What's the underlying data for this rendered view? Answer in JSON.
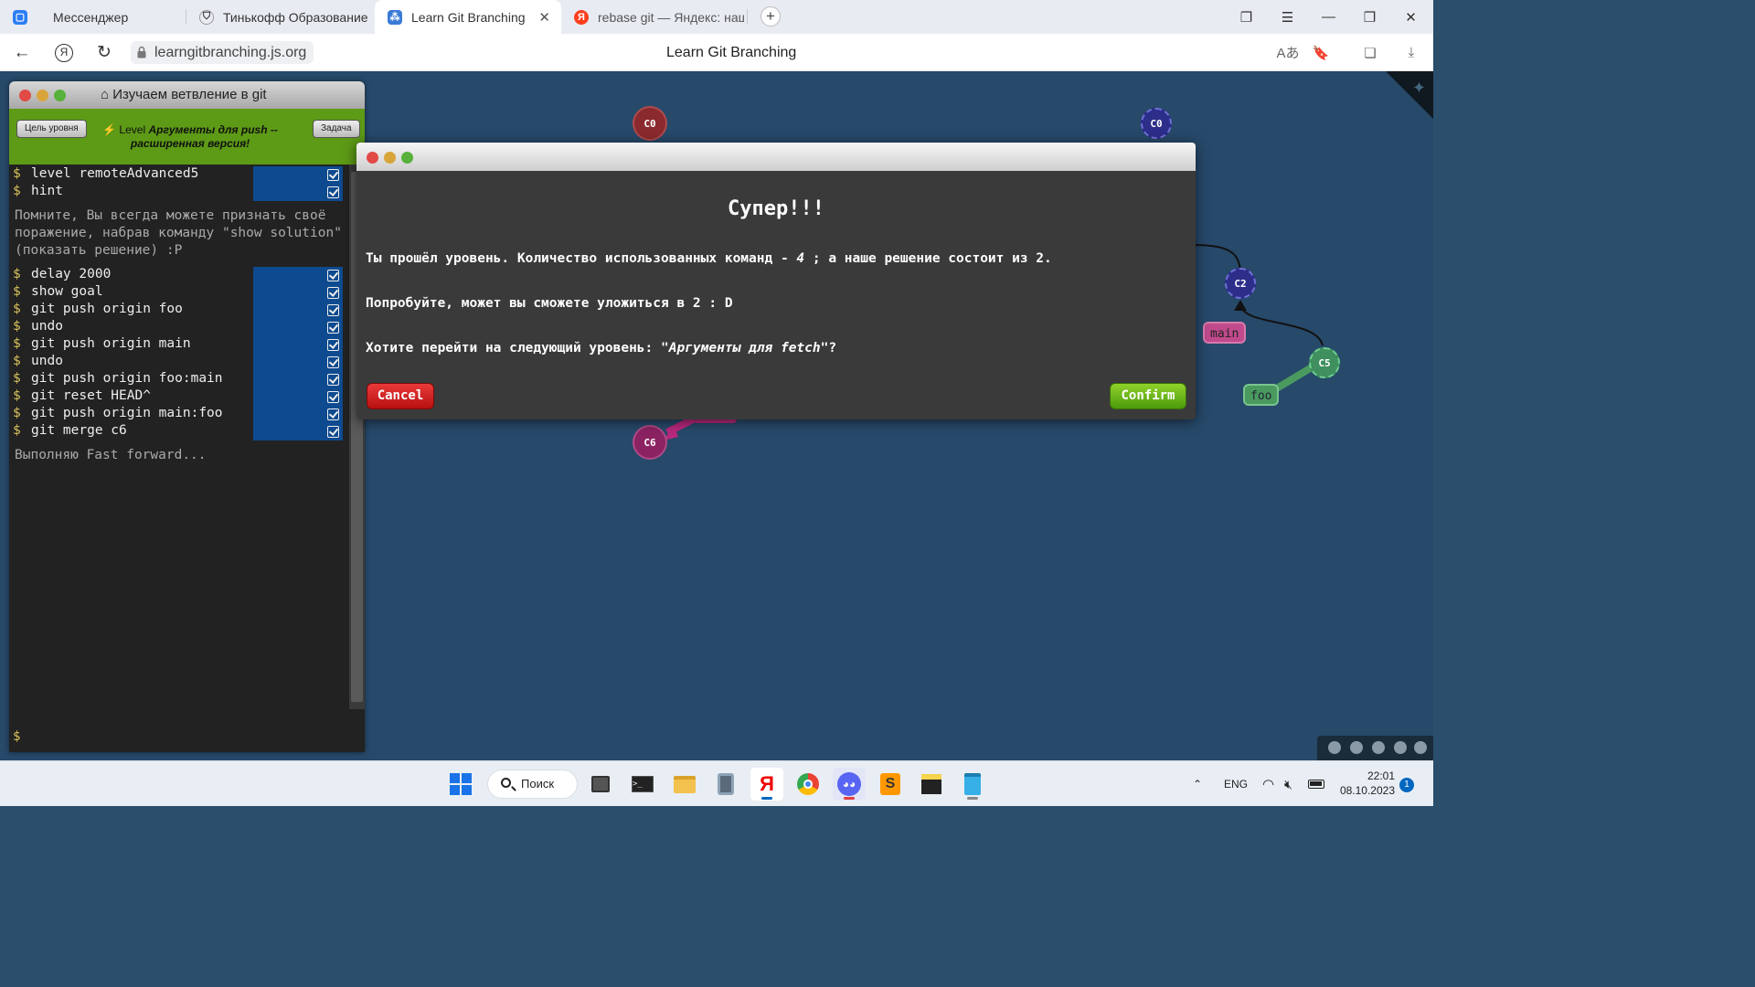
{
  "browser": {
    "tabs": [
      {
        "label": "Мессенджер"
      },
      {
        "label": "Тинькофф Образование"
      },
      {
        "label": "Learn Git Branching"
      },
      {
        "label": "rebase git — Яндекс: нашл"
      }
    ],
    "url": "learngitbranching.js.org",
    "page_title": "Learn Git Branching",
    "yandex_letter": "Я"
  },
  "panel": {
    "title": "Изучаем ветвление в git",
    "goal_button": "Цель уровня",
    "task_button": "Задача",
    "level_prefix": "Level",
    "level_name": "Аргументы для push -- расширенная версия!",
    "prompt": "$",
    "commands_top": [
      {
        "cmd": "level remoteAdvanced5"
      },
      {
        "cmd": "hint"
      }
    ],
    "hint_message": "Помните, Вы всегда можете признать своё поражение, набрав команду \"show solution\" (показать решение) :P",
    "commands": [
      {
        "cmd": "delay 2000"
      },
      {
        "cmd": "show goal"
      },
      {
        "cmd": "git push origin foo"
      },
      {
        "cmd": "undo"
      },
      {
        "cmd": "git push origin main"
      },
      {
        "cmd": "undo"
      },
      {
        "cmd": "git push origin foo:main"
      },
      {
        "cmd": "git reset HEAD^"
      },
      {
        "cmd": "git push origin main:foo"
      },
      {
        "cmd": "git merge c6"
      }
    ],
    "result_message": "Выполняю Fast forward..."
  },
  "graph": {
    "nodes": [
      {
        "label": "C0"
      },
      {
        "label": "C0"
      },
      {
        "label": "C2"
      },
      {
        "label": "C5"
      },
      {
        "label": "C6"
      }
    ],
    "branches": [
      {
        "label": "main"
      },
      {
        "label": "foo"
      }
    ]
  },
  "modal": {
    "heading": "Супер!!!",
    "line1_a": "Ты прошёл уровень. Количество использованных команд - ",
    "line1_count": "4",
    "line1_b": " ; а наше решение состоит из 2.",
    "line2": "Попробуйте, может вы сможете уложиться в 2 : D",
    "line3_a": "Хотите перейти на следующий уровень: ",
    "line3_level": "\"Аргументы для fetch\"",
    "line3_b": "?",
    "cancel": "Cancel",
    "confirm": "Confirm"
  },
  "taskbar": {
    "search": "Поиск",
    "lang": "ENG",
    "time": "22:01",
    "date": "08.10.2023",
    "notifications": "1"
  },
  "colors": {
    "canvas_bg": "#27496a",
    "node_red": "#8b2a2e",
    "node_blue": "#2d2d8a",
    "node_green": "#3f8f5f",
    "node_magenta": "#8b2262",
    "level_bar": "#5d9a16"
  }
}
